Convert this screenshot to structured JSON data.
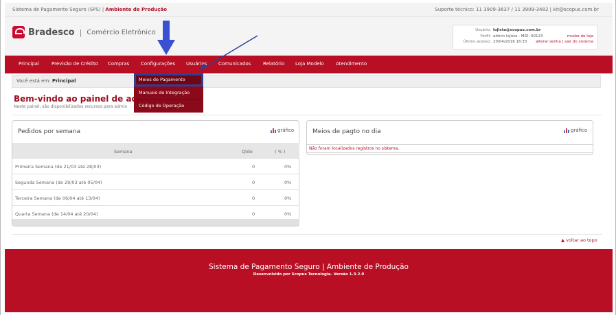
{
  "topbar": {
    "system": "Sistema de Pagamento Seguro (SPS)",
    "separator": "|",
    "environment": "Ambiente de Produção",
    "support": "Suporte técnico: 11 3909-3637 / 11 3909-3482 | kit@scopus.com.br"
  },
  "header": {
    "brand": "Bradesco",
    "separator": "|",
    "subtitle": "Comércio Eletrônico"
  },
  "userbox": {
    "user_label": "Usuário:",
    "user_value": "lojista@scopus.com.br",
    "profile_label": "Perfil:",
    "profile_value": "admin lojista - MID: 00123",
    "last_access_label": "Último acesso:",
    "last_access_value": "20/04/2016 16:33",
    "change_store": "mudar de loja",
    "change_password": "alterar senha | sair do sistema"
  },
  "nav": {
    "items": [
      "Principal",
      "Previsão de Crédito",
      "Compras",
      "Configurações",
      "Usuários",
      "Comunicados",
      "Relatório",
      "Loja Modelo",
      "Atendimento"
    ]
  },
  "dropdown": {
    "items": [
      "Meios de Pagamento",
      "Manuais de Integração",
      "Código de Operação"
    ]
  },
  "breadcrumb": {
    "prefix": "Você está em:",
    "current": "Principal"
  },
  "welcome": {
    "title": "Bem-vindo ao painel de administ",
    "subtitle": "Neste painel, são disponibilizados recursos para admin"
  },
  "orders_panel": {
    "title": "Pedidos por semana",
    "chart_link": "gráfico",
    "columns": [
      "Semana",
      "Qtde",
      "( % )"
    ],
    "rows": [
      {
        "week": "Primeira Semana (de 21/03 até 28/03)",
        "qty": "0",
        "pct": "0%"
      },
      {
        "week": "Segunda Semana (de 29/03 até 05/04)",
        "qty": "0",
        "pct": "0%"
      },
      {
        "week": "Terceira Semana (de 06/04 até 13/04)",
        "qty": "0",
        "pct": "0%"
      },
      {
        "week": "Quarta Semana (de 14/04 até 20/04)",
        "qty": "0",
        "pct": "0%"
      }
    ]
  },
  "payments_panel": {
    "title": "Meios de pagto no dia",
    "chart_link": "gráfico",
    "empty_message": "Não foram localizados registros no sistema."
  },
  "back_to_top": "▲ voltar ao topo",
  "footer": {
    "title": "Sistema de Pagamento Seguro | Ambiente de Produção",
    "subtitle": "Desenvolvido por Scopus Tecnologia. Versão 1.3.2.0"
  },
  "colors": {
    "brand_red": "#b80f24",
    "highlight_blue": "#2e3f99",
    "annotation_blue": "#3a4fd1"
  }
}
